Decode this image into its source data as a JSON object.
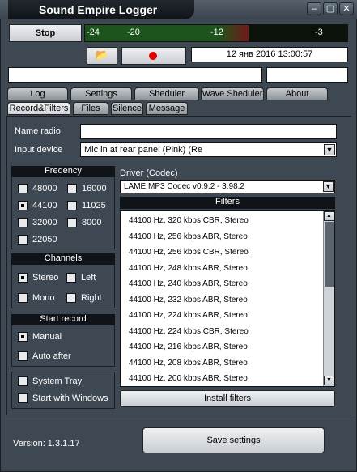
{
  "window": {
    "title": "Sound Empire Logger"
  },
  "toolbar": {
    "stop_label": "Stop",
    "datetime": "12 янв 2016  13:00:57"
  },
  "meter": {
    "ticks": [
      "-24",
      "-20",
      "-12",
      "-3"
    ],
    "level": 0.62
  },
  "main_tabs": [
    "Log",
    "Settings",
    "Sheduler",
    "Wave Sheduler",
    "About"
  ],
  "sub_tabs": [
    "Record&Filters",
    "Files",
    "Silence",
    "Message"
  ],
  "form": {
    "name_radio_label": "Name radio",
    "name_radio_value": "",
    "input_device_label": "Input device",
    "input_device_value": "Mic in at rear panel (Pink) (Re"
  },
  "frequency": {
    "title": "Freqency",
    "options": [
      "48000",
      "16000",
      "44100",
      "11025",
      "32000",
      "8000",
      "22050"
    ],
    "selected": "44100"
  },
  "channels": {
    "title": "Channels",
    "options": [
      "Stereo",
      "Left",
      "Mono",
      "Right"
    ],
    "selected": "Stereo"
  },
  "start_record": {
    "title": "Start record",
    "options": [
      "Manual",
      "Auto after"
    ],
    "selected": "Manual"
  },
  "extra": {
    "system_tray": "System Tray",
    "start_windows": "Start with Windows"
  },
  "driver": {
    "label": "Driver (Codec)",
    "value": "LAME MP3 Codec v0.9.2 - 3.98.2",
    "filters_title": "Filters",
    "install_label": "Install filters"
  },
  "filters": [
    "44100 Hz, 320 kbps CBR, Stereo",
    "44100 Hz, 256 kbps ABR, Stereo",
    "44100 Hz, 256 kbps CBR, Stereo",
    "44100 Hz, 248 kbps ABR, Stereo",
    "44100 Hz, 240 kbps ABR, Stereo",
    "44100 Hz, 232 kbps ABR, Stereo",
    "44100 Hz, 224 kbps ABR, Stereo",
    "44100 Hz, 224 kbps CBR, Stereo",
    "44100 Hz, 216 kbps ABR, Stereo",
    "44100 Hz, 208 kbps ABR, Stereo",
    "44100 Hz, 200 kbps ABR, Stereo"
  ],
  "footer": {
    "version": "Version: 1.3.1.17",
    "save_label": "Save settings"
  },
  "colors": {
    "window": "#3e4853",
    "meter_green": "#2d8a2d",
    "meter_red": "#c82020",
    "record_dot": "#e00000"
  }
}
